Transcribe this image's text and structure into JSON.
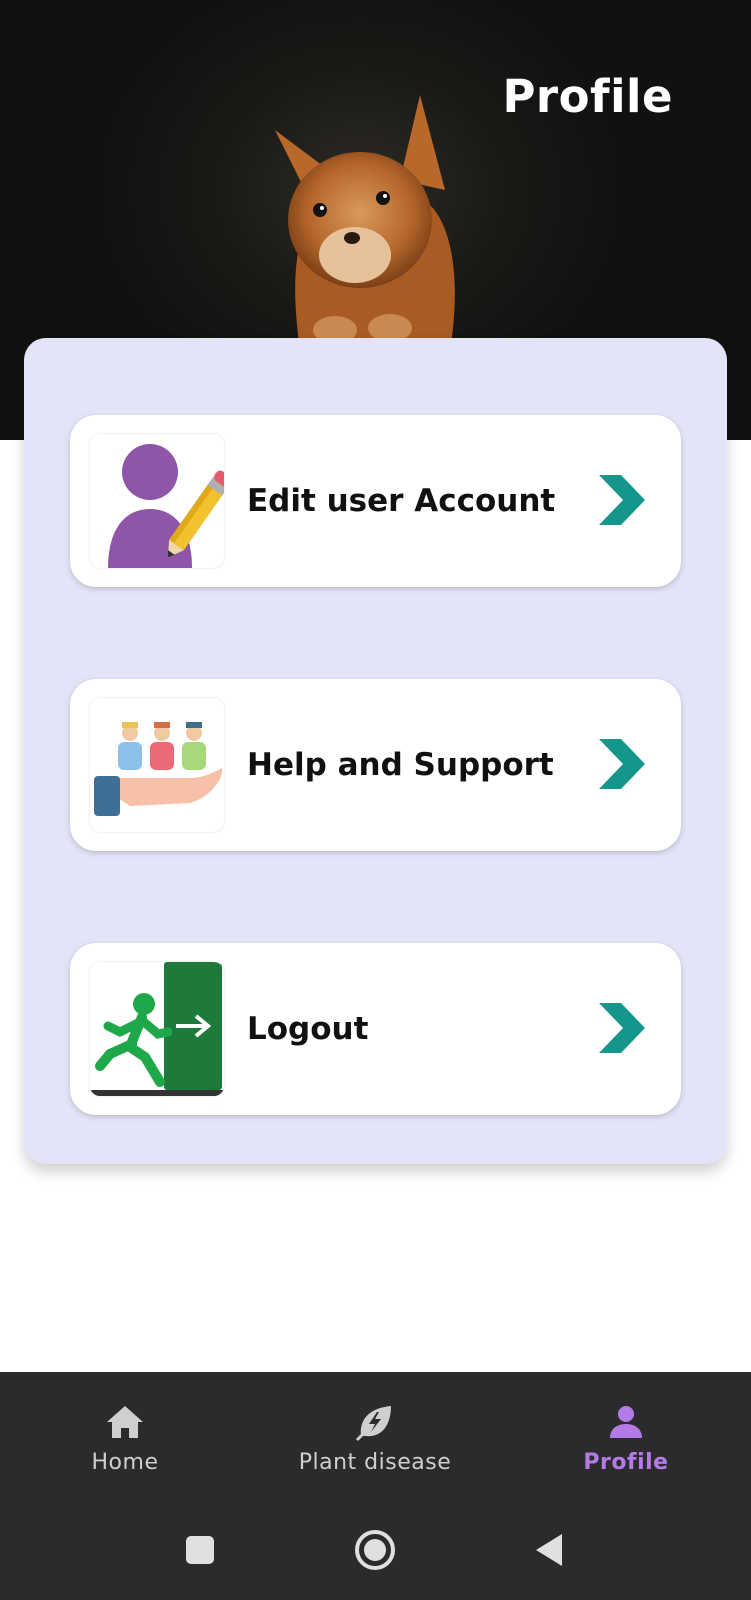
{
  "header": {
    "title": "Profile"
  },
  "menu": [
    {
      "label": "Edit user Account",
      "icon": "edit-user-icon"
    },
    {
      "label": "Help and Support",
      "icon": "support-hand-icon"
    },
    {
      "label": "Logout",
      "icon": "exit-door-icon"
    }
  ],
  "bottom_nav": {
    "items": [
      {
        "label": "Home",
        "icon": "home-icon",
        "active": false
      },
      {
        "label": "Plant disease",
        "icon": "leaf-bolt-icon",
        "active": false
      },
      {
        "label": "Profile",
        "icon": "person-icon",
        "active": true
      }
    ]
  },
  "system_nav": {
    "buttons": [
      "recent-apps",
      "home",
      "back"
    ]
  },
  "colors": {
    "accent": "#b47ae6",
    "card_bg": "#e4e4f8",
    "arrow": "#14968a",
    "nav_bg": "#2b2b2d"
  }
}
